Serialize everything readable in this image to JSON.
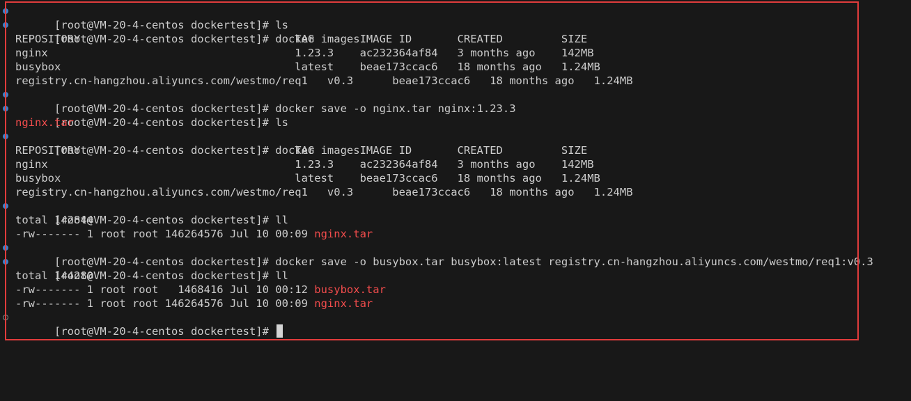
{
  "terminal": {
    "prompt": "[root@VM-20-4-centos dockertest]# ",
    "table_header": "REPOSITORY                                 TAG       IMAGE ID       CREATED         SIZE",
    "row_nginx": "nginx                                      1.23.3    ac232364af84   3 months ago    142MB",
    "row_busybox": "busybox                                    latest    beae173ccac6   18 months ago   1.24MB",
    "row_registry": "registry.cn-hangzhou.aliyuncs.com/westmo/req1   v0.3      beae173ccac6   18 months ago   1.24MB",
    "cmds": {
      "ls": "ls",
      "docker_images": "docker images",
      "save_nginx": "docker save -o nginx.tar nginx:1.23.3",
      "ll": "ll",
      "save_busybox": "docker save -o busybox.tar busybox:latest registry.cn-hangzhou.aliyuncs.com/westmo/req1:v0.3"
    },
    "ls_output": "nginx.tar",
    "total_1": "total 142844",
    "ll1_file_prefix": "-rw------- 1 root root 146264576 Jul 10 00:09 ",
    "ll1_file_name": "nginx.tar",
    "total_2": "total 144280",
    "ll2_file1_prefix": "-rw------- 1 root root   1468416 Jul 10 00:12 ",
    "ll2_file1_name": "busybox.tar",
    "ll2_file2_prefix": "-rw------- 1 root root 146264576 Jul 10 00:09 ",
    "ll2_file2_name": "nginx.tar"
  },
  "colors": {
    "background": "#181818",
    "text": "#cccccc",
    "file_red": "#f14c4c",
    "highlight_border": "#e03c3c",
    "deco_blue": "#3d7fc9"
  }
}
